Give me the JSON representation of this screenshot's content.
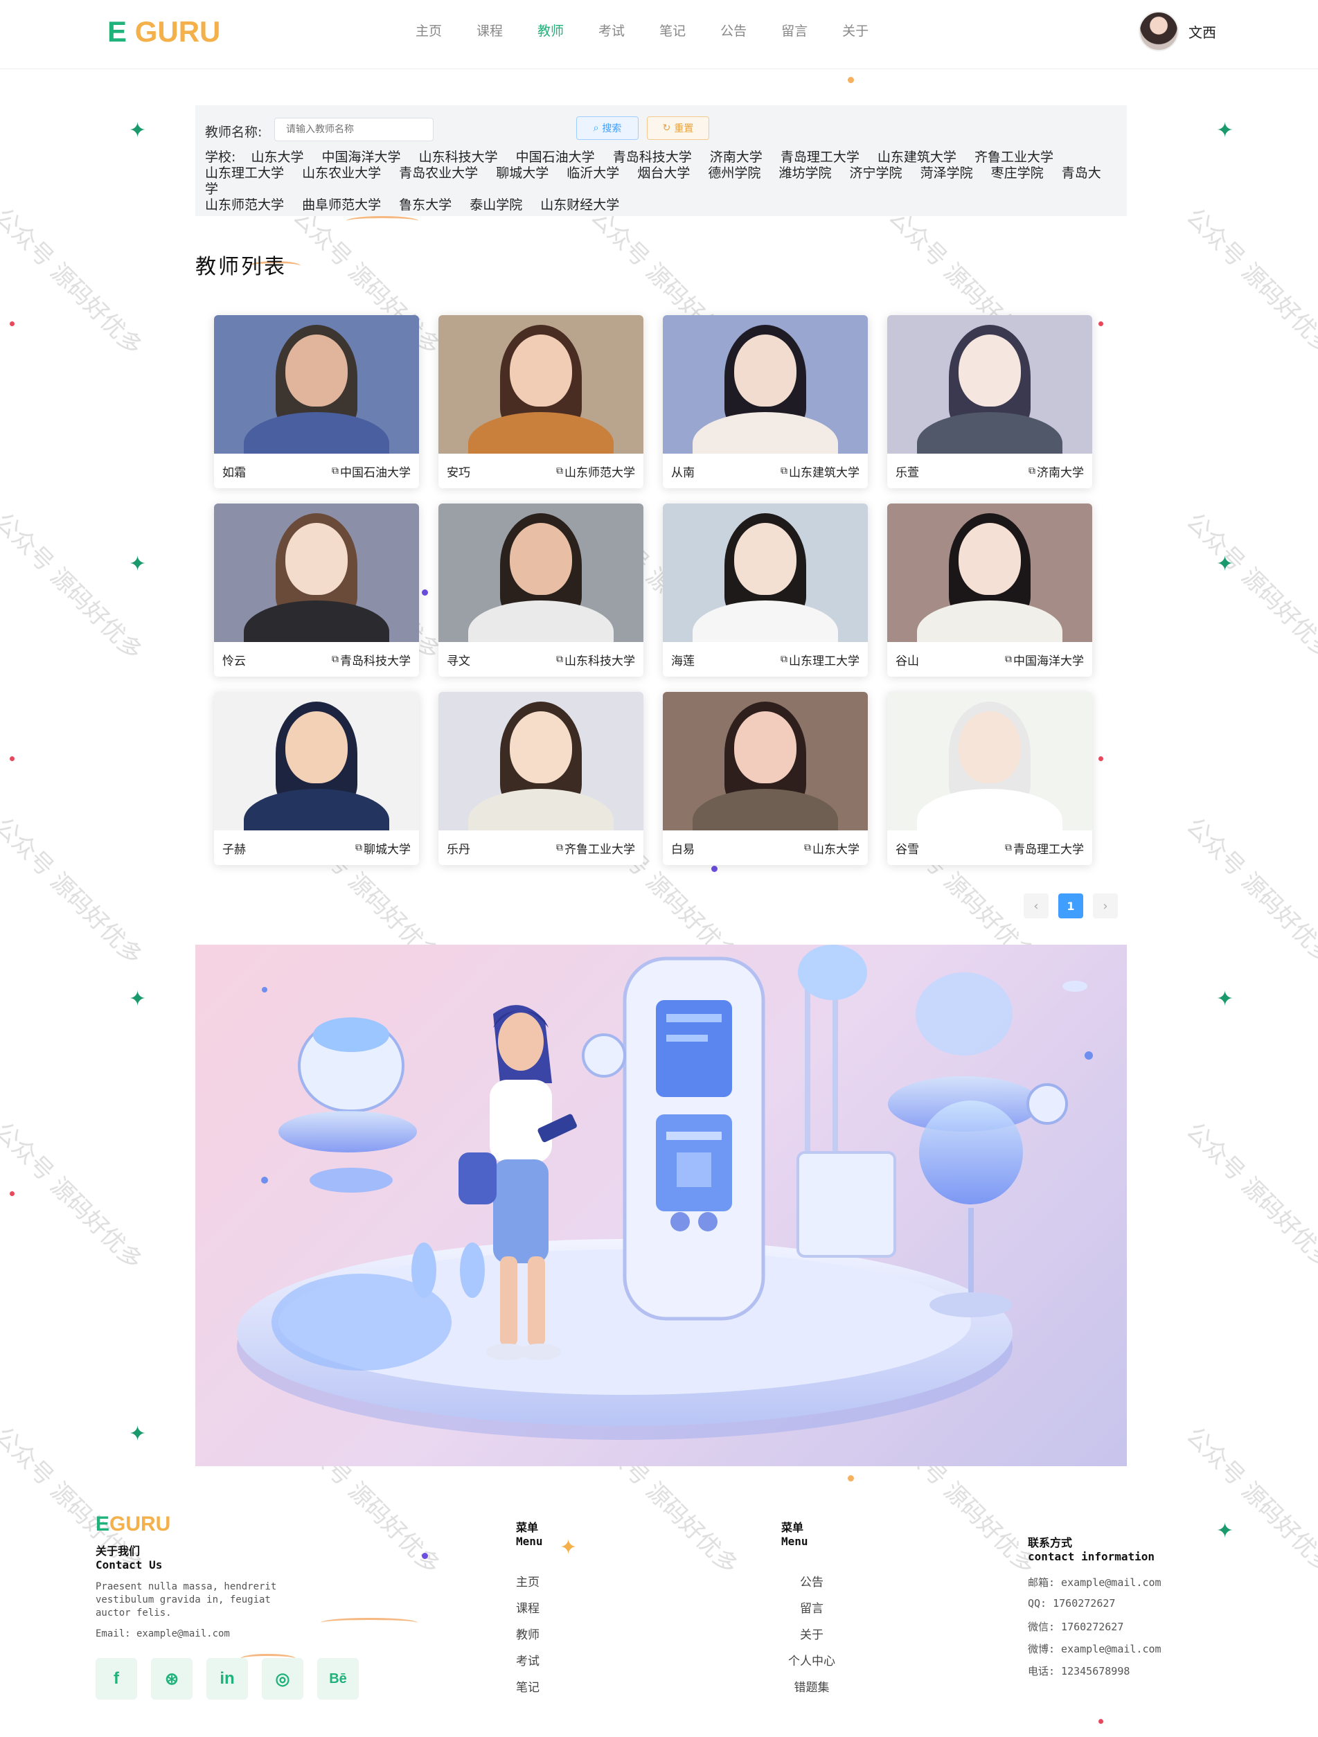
{
  "header": {
    "logo_e": "E",
    "logo_guru": "GURU",
    "nav": [
      "主页",
      "课程",
      "教师",
      "考试",
      "笔记",
      "公告",
      "留言",
      "关于"
    ],
    "active_nav": "教师",
    "user_name": "文西"
  },
  "filter": {
    "name_label": "教师名称:",
    "name_placeholder": "请输入教师名称",
    "search_label": "搜索",
    "reset_label": "重置",
    "school_label": "学校:",
    "schools": [
      "山东大学",
      "中国海洋大学",
      "山东科技大学",
      "中国石油大学",
      "青岛科技大学",
      "济南大学",
      "青岛理工大学",
      "山东建筑大学",
      "齐鲁工业大学",
      "山东理工大学",
      "山东农业大学",
      "青岛农业大学",
      "聊城大学",
      "临沂大学",
      "烟台大学",
      "德州学院",
      "潍坊学院",
      "济宁学院",
      "菏泽学院",
      "枣庄学院",
      "青岛大学",
      "山东师范大学",
      "曲阜师范大学",
      "鲁东大学",
      "泰山学院",
      "山东财经大学"
    ]
  },
  "section_title": "教师列表",
  "teachers": [
    {
      "name": "如霜",
      "school": "中国石油大学"
    },
    {
      "name": "安巧",
      "school": "山东师范大学"
    },
    {
      "name": "从南",
      "school": "山东建筑大学"
    },
    {
      "name": "乐萱",
      "school": "济南大学"
    },
    {
      "name": "怜云",
      "school": "青岛科技大学"
    },
    {
      "name": "寻文",
      "school": "山东科技大学"
    },
    {
      "name": "海莲",
      "school": "山东理工大学"
    },
    {
      "name": "谷山",
      "school": "中国海洋大学"
    },
    {
      "name": "子赫",
      "school": "聊城大学"
    },
    {
      "name": "乐丹",
      "school": "齐鲁工业大学"
    },
    {
      "name": "白易",
      "school": "山东大学"
    },
    {
      "name": "谷雪",
      "school": "青岛理工大学"
    }
  ],
  "pagination": {
    "prev": "‹",
    "current": "1",
    "next": "›"
  },
  "footer": {
    "logo_e": "E",
    "logo_guru": "GURU",
    "about_cn": "关于我们",
    "about_en": "Contact Us",
    "about_text": "Praesent nulla massa, hendrerit vestibulum gravida in, feugiat auctor felis.",
    "about_email": "Email: example@mail.com",
    "menu1_cn": "菜单",
    "menu1_en": "Menu",
    "menu1": [
      "主页",
      "课程",
      "教师",
      "考试",
      "笔记"
    ],
    "menu2_cn": "菜单",
    "menu2_en": "Menu",
    "menu2": [
      "公告",
      "留言",
      "关于",
      "个人中心",
      "错题集"
    ],
    "contact_cn": "联系方式",
    "contact_en": "contact information",
    "contact": [
      "邮箱: example@mail.com",
      "QQ: 1760272627",
      "微信: 1760272627",
      "微博: example@mail.com",
      "电话: 12345678998"
    ],
    "social": [
      "f",
      "⊛",
      "in",
      "◎",
      "Bē"
    ]
  },
  "watermark": "公众号 源码好优多",
  "colors": {
    "brand_green": "#1fb27a",
    "brand_orange": "#f4b04a",
    "primary_blue": "#409eff"
  }
}
